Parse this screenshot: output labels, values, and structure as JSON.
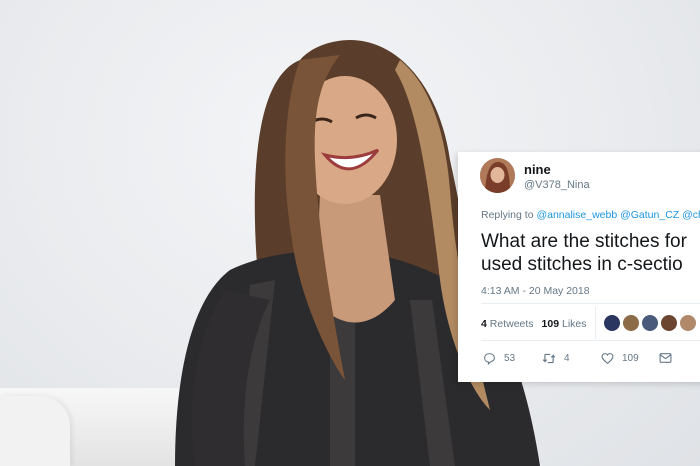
{
  "tweet": {
    "display_name": "nine",
    "handle": "@V378_Nina",
    "reply_prefix": "Replying to ",
    "reply_mentions": [
      "@annalise_webb",
      "@Gatun_CZ",
      "@chris"
    ],
    "body_lines": [
      "What are the stitches for",
      "used stitches in c-sectio"
    ],
    "timestamp": "4:13 AM - 20 May 2018",
    "retweets_count": "4",
    "retweets_label": "Retweets",
    "likes_count": "109",
    "likes_label": "Likes",
    "likers": [
      "liker-avatar-1",
      "liker-avatar-2",
      "liker-avatar-3",
      "liker-avatar-4",
      "liker-avatar-5"
    ],
    "actions": {
      "reply_count": "53",
      "retweet_count": "4",
      "like_count": "109"
    }
  },
  "icons": [
    "reply-icon",
    "retweet-icon",
    "like-icon",
    "message-icon"
  ],
  "colors": {
    "mention": "#1b95e0",
    "secondary_text": "#657786",
    "primary_text": "#14171a"
  }
}
